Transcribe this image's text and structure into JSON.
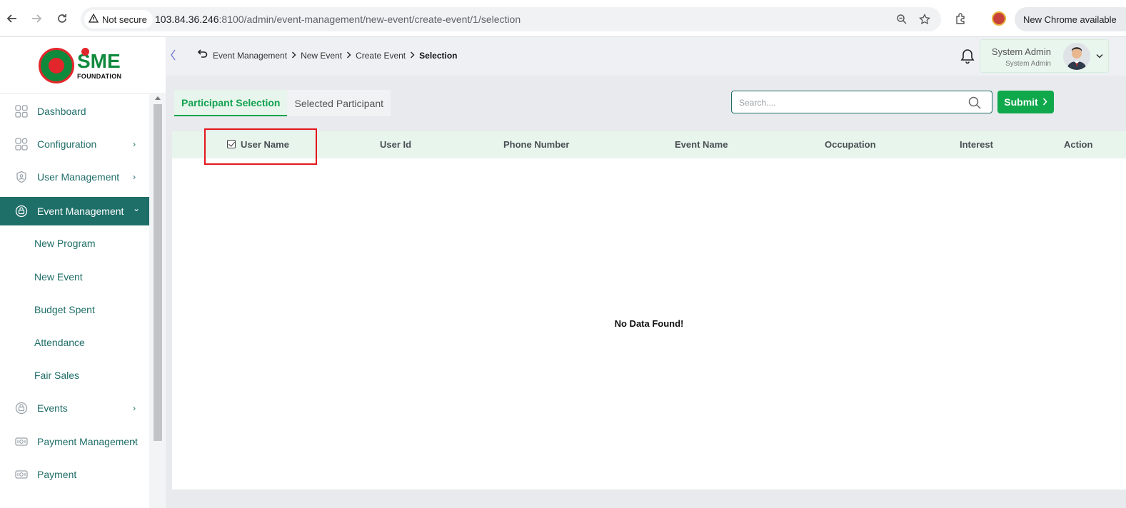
{
  "browser": {
    "security_label": "Not secure",
    "url_host": "103.84.36.246",
    "url_path": ":8100/admin/event-management/new-event/create-event/1/selection",
    "update_label": "New Chrome available"
  },
  "brand": {
    "logo_text": "SME",
    "logo_subtext": "FOUNDATION"
  },
  "sidebar": {
    "items": [
      {
        "label": "Dashboard",
        "icon": "grid-icon",
        "has_chevron": false
      },
      {
        "label": "Configuration",
        "icon": "config-icon",
        "has_chevron": true
      },
      {
        "label": "User Management",
        "icon": "shield-user-icon",
        "has_chevron": true
      },
      {
        "label": "Event Management",
        "icon": "event-icon",
        "has_chevron": true,
        "active": true
      },
      {
        "label": "Events",
        "icon": "event-icon",
        "has_chevron": true
      },
      {
        "label": "Payment Management",
        "icon": "payment-icon",
        "has_chevron": true
      },
      {
        "label": "Payment",
        "icon": "payment-icon",
        "has_chevron": false
      }
    ],
    "sub_items": [
      "New Program",
      "New Event",
      "Budget Spent",
      "Attendance",
      "Fair Sales"
    ],
    "chevron_right": "›",
    "chevron_down": "⌄"
  },
  "topbar": {
    "breadcrumb": [
      "Event Management",
      "New Event",
      "Create Event",
      "Selection"
    ],
    "user_name": "System Admin",
    "user_role": "System Admin"
  },
  "tabs": [
    "Participant Selection",
    "Selected Participant"
  ],
  "search": {
    "placeholder": "Search....",
    "value": ""
  },
  "submit_label": "Submit",
  "table": {
    "columns": [
      "User Name",
      "User Id",
      "Phone Number",
      "Event Name",
      "Occupation",
      "Interest",
      "Action"
    ],
    "select_all_checked": true,
    "empty_message": "No Data Found!"
  },
  "colors": {
    "accent_green": "#0fa84b",
    "teal": "#1e6f68",
    "highlight_red": "#e3161c"
  }
}
